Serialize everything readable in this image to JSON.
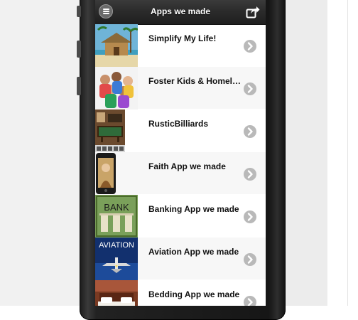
{
  "header": {
    "title": "Apps we made",
    "menu_icon": "menu-icon",
    "share_icon": "share-icon"
  },
  "list": {
    "items": [
      {
        "label": "Simplify My Life!",
        "thumb_icon": "beach-hut-thumbnail"
      },
      {
        "label": "Foster Kids & Homel…",
        "thumb_icon": "kids-group-thumbnail"
      },
      {
        "label": "RusticBilliards",
        "thumb_icon": "billiards-room-thumbnail"
      },
      {
        "label": "Faith App we made",
        "thumb_icon": "phone-app-thumbnail"
      },
      {
        "label": "Banking App we made",
        "thumb_icon": "bank-thumbnail"
      },
      {
        "label": "Aviation App we made",
        "thumb_icon": "airplane-thumbnail"
      },
      {
        "label": "Bedding App we made",
        "thumb_icon": "bedroom-thumbnail"
      }
    ],
    "bank_sign_text": "BANK",
    "aviation_sign_text": "AVIATION"
  },
  "colors": {
    "header": "#2a2a2a",
    "chevron": "#b9b9b9",
    "row_alt": "#f7f7f7"
  }
}
